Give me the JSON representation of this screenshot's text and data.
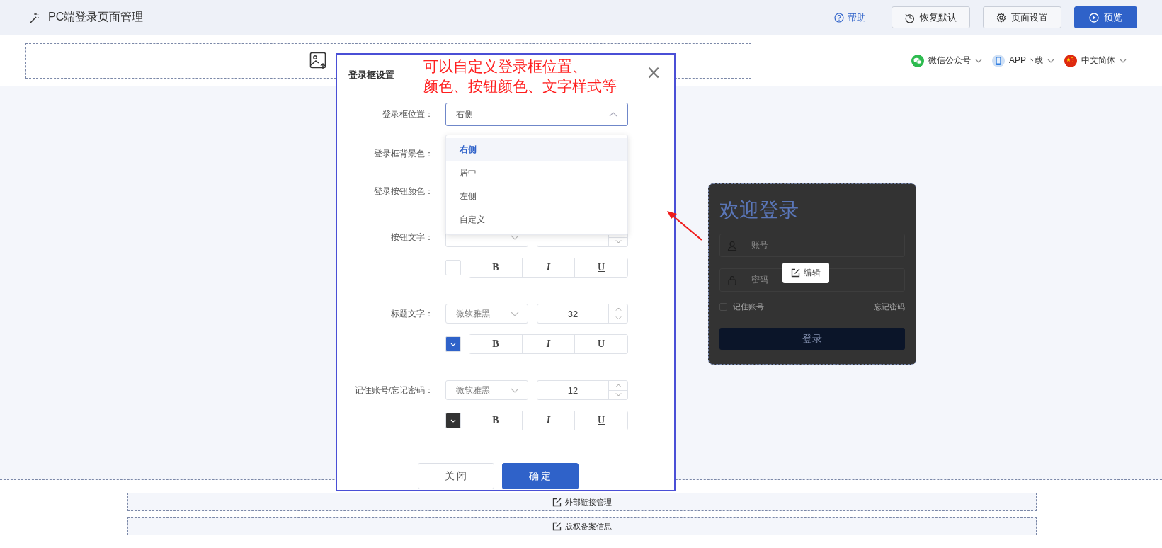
{
  "header": {
    "title": "PC端登录页面管理",
    "help": "帮助",
    "buttons": [
      {
        "label": "恢复默认",
        "kind": "restore"
      },
      {
        "label": "页面设置",
        "kind": "settings"
      },
      {
        "label": "预览",
        "kind": "preview"
      }
    ]
  },
  "top_bar": {
    "links": [
      {
        "label": "微信公众号",
        "kind": "wechat"
      },
      {
        "label": "APP下载",
        "kind": "app"
      },
      {
        "label": "中文简体",
        "kind": "language"
      }
    ]
  },
  "login_preview": {
    "title": "欢迎登录",
    "username_placeholder": "账号",
    "password_placeholder": "密码",
    "remember": "记住账号",
    "remember_checked": false,
    "forgot": "忘记密码",
    "submit": "登录",
    "edit": "编辑"
  },
  "footer_sections": [
    {
      "label": "外部链接管理"
    },
    {
      "label": "版权备案信息"
    }
  ],
  "dialog": {
    "title": "登录框设置",
    "close": "×",
    "fields": [
      {
        "kind": "select",
        "label": "登录框位置：",
        "value": "右侧",
        "expanded": true,
        "options": [
          {
            "label": "右侧",
            "selected": true
          },
          {
            "label": "居中",
            "selected": false
          },
          {
            "label": "左侧",
            "selected": false
          },
          {
            "label": "自定义",
            "selected": false
          }
        ]
      },
      {
        "kind": "color",
        "label": "登录框背景色："
      },
      {
        "kind": "color",
        "label": "登录按钮颜色："
      },
      {
        "kind": "text_style",
        "label": "按钮文字：",
        "color": "#ffffff",
        "styles": [
          "B",
          "I",
          "U"
        ]
      },
      {
        "kind": "text_style",
        "label": "标题文字：",
        "font": "微软雅黑",
        "size": "32",
        "color": "#2f62c9",
        "styles": [
          "B",
          "I",
          "U"
        ]
      },
      {
        "kind": "text_style",
        "label": "记住账号/忘记密码：",
        "font": "微软雅黑",
        "size": "12",
        "color": "#333333",
        "styles": [
          "B",
          "I",
          "U"
        ]
      }
    ],
    "buttons": [
      {
        "label": "关 闭",
        "kind": "secondary"
      },
      {
        "label": "确 定",
        "kind": "primary"
      }
    ]
  },
  "annotation": {
    "lines": [
      "可以自定义登录框位置、",
      "颜色、按钮颜色、文字样式等"
    ]
  }
}
